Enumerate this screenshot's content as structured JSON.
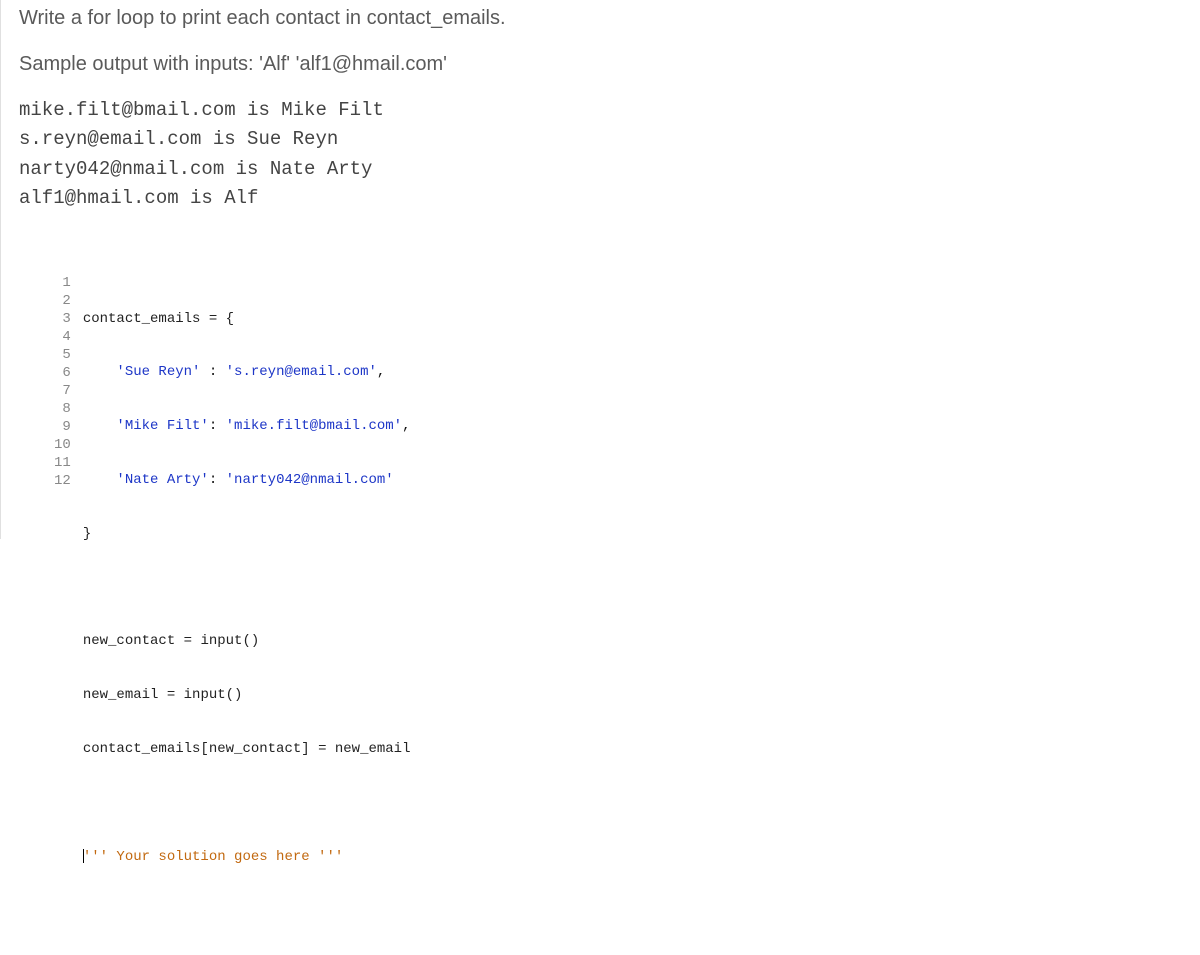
{
  "prompt": {
    "line1": "Write a for loop to print each contact in contact_emails.",
    "line2": "Sample output with inputs: 'Alf' 'alf1@hmail.com'"
  },
  "sample_output": "mike.filt@bmail.com is Mike Filt\ns.reyn@email.com is Sue Reyn\nnarty042@nmail.com is Nate Arty\nalf1@hmail.com is Alf",
  "editor": {
    "gutter": [
      "1",
      "2",
      "3",
      "4",
      "5",
      "6",
      "7",
      "8",
      "9",
      "10",
      "11",
      "12"
    ],
    "lines": {
      "l1a": "contact_emails ",
      "l1b": "=",
      "l1c": " {",
      "l2a": "    ",
      "l2b": "'Sue Reyn'",
      "l2c": " : ",
      "l2d": "'s.reyn@email.com'",
      "l2e": ",",
      "l3a": "    ",
      "l3b": "'Mike Filt'",
      "l3c": ": ",
      "l3d": "'mike.filt@bmail.com'",
      "l3e": ",",
      "l4a": "    ",
      "l4b": "'Nate Arty'",
      "l4c": ": ",
      "l4d": "'narty042@nmail.com'",
      "l5": "}",
      "l6": "",
      "l7a": "new_contact ",
      "l7b": "=",
      "l7c": " input()",
      "l8a": "new_email ",
      "l8b": "=",
      "l8c": " input()",
      "l9a": "contact_emails[new_contact] ",
      "l9b": "=",
      "l9c": " new_email",
      "l10": "",
      "l11a": "''' Your solution goes here '''",
      "l12": ""
    }
  }
}
